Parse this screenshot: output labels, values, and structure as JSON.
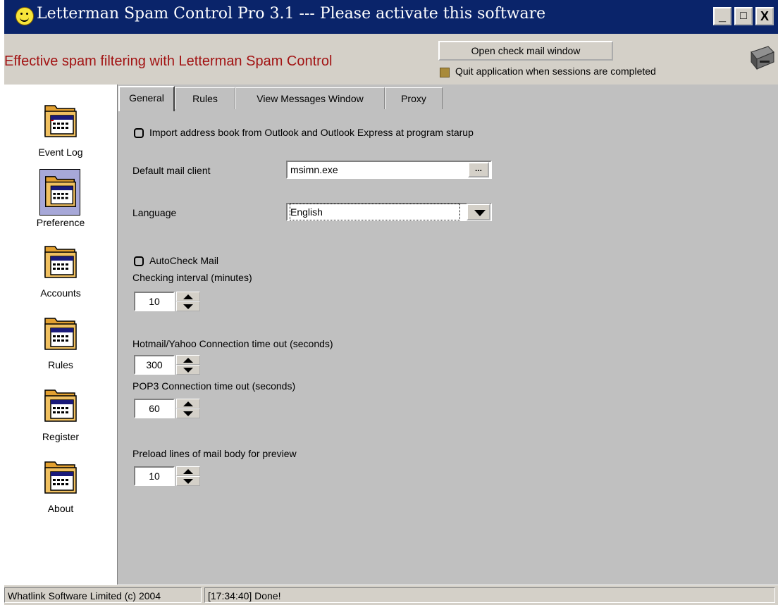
{
  "window": {
    "title": "Letterman Spam Control Pro 3.1 --- Please activate this software",
    "minimize": "_",
    "maximize": "□",
    "close": "X"
  },
  "header": {
    "tagline": "Effective spam filtering with Letterman Spam Control",
    "open_check_mail_label": "Open check mail window",
    "quit_label": "Quit application when sessions are completed",
    "tagline_color": "#a21313"
  },
  "sidebar": {
    "items": [
      {
        "label": "Event Log",
        "icon": "folder-calendar-icon",
        "selected": false
      },
      {
        "label": "Preference",
        "icon": "folder-calendar-icon",
        "selected": true
      },
      {
        "label": "Accounts",
        "icon": "folder-calendar-icon",
        "selected": false
      },
      {
        "label": "Rules",
        "icon": "folder-calendar-icon",
        "selected": false
      },
      {
        "label": "Register",
        "icon": "folder-calendar-icon",
        "selected": false
      },
      {
        "label": "About",
        "icon": "folder-calendar-icon",
        "selected": false
      }
    ]
  },
  "tabs": [
    {
      "label": "General",
      "active": true
    },
    {
      "label": "Rules",
      "active": false
    },
    {
      "label": "View Messages Window",
      "active": false
    },
    {
      "label": "Proxy",
      "active": false
    }
  ],
  "general": {
    "import_label": "Import address book from Outlook and Outlook Express at program starup",
    "default_mail_client_label": "Default mail client",
    "default_mail_client_value": "msimn.exe",
    "browse_label": "...",
    "language_label": "Language",
    "language_value": "English",
    "autocheck_label": "AutoCheck Mail",
    "checking_interval_label": "Checking interval (minutes)",
    "checking_interval_value": "10",
    "hotmail_timeout_label": "Hotmail/Yahoo Connection time out (seconds)",
    "hotmail_timeout_value": "300",
    "pop3_timeout_label": "POP3 Connection time out (seconds)",
    "pop3_timeout_value": "60",
    "preload_label": "Preload lines of mail body for preview",
    "preload_value": "10"
  },
  "status": {
    "copyright": "Whatlink Software Limited (c) 2004",
    "message": "[17:34:40] Done!"
  },
  "colors": {
    "titlebar": "#0a246a",
    "face": "#c0c0c0",
    "selection": "#a7a8d8"
  }
}
